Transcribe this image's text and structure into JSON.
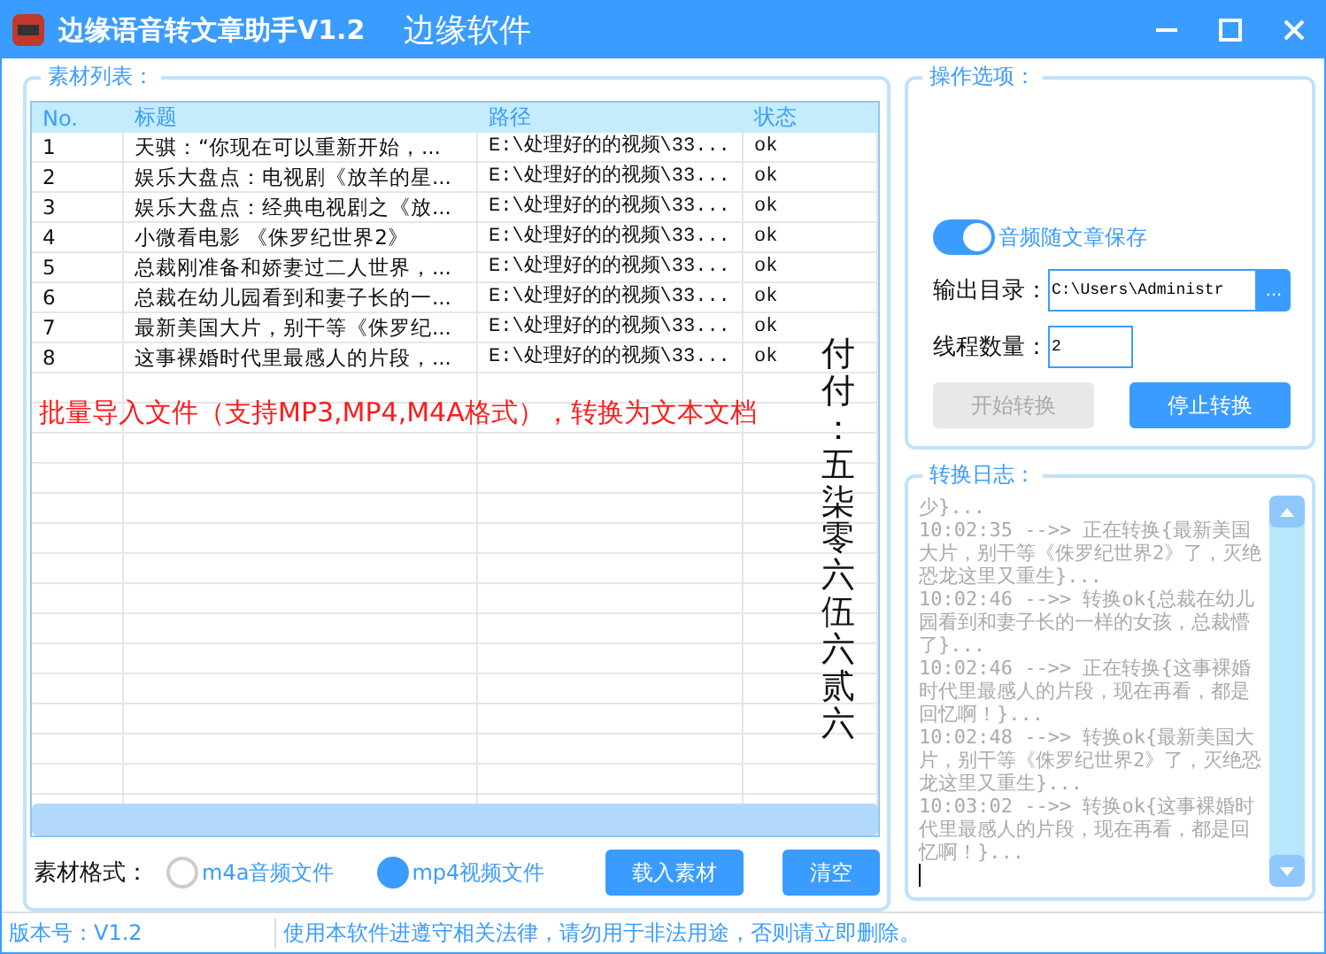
{
  "window": {
    "title": "边缘语音转文章助手V1.2",
    "subtitle": "边缘软件"
  },
  "materials": {
    "label": "素材列表：",
    "columns": [
      "No.",
      "标题",
      "路径",
      "状态"
    ],
    "rows": [
      {
        "no": "1",
        "title": "天骐：“你现在可以重新开始，...",
        "path": "E:\\处理好的的视频\\33...",
        "status": "ok"
      },
      {
        "no": "2",
        "title": "娱乐大盘点：电视剧《放羊的星...",
        "path": "E:\\处理好的的视频\\33...",
        "status": "ok"
      },
      {
        "no": "3",
        "title": "娱乐大盘点：经典电视剧之《放...",
        "path": "E:\\处理好的的视频\\33...",
        "status": "ok"
      },
      {
        "no": "4",
        "title": "小微看电影 《侏罗纪世界2》",
        "path": "E:\\处理好的的视频\\33...",
        "status": "ok"
      },
      {
        "no": "5",
        "title": "总裁刚准备和娇妻过二人世界，...",
        "path": "E:\\处理好的的视频\\33...",
        "status": "ok"
      },
      {
        "no": "6",
        "title": "总裁在幼儿园看到和妻子长的一...",
        "path": "E:\\处理好的的视频\\33...",
        "status": "ok"
      },
      {
        "no": "7",
        "title": "最新美国大片，别干等《侏罗纪...",
        "path": "E:\\处理好的的视频\\33...",
        "status": "ok"
      },
      {
        "no": "8",
        "title": "这事裸婚时代里最感人的片段，...",
        "path": "E:\\处理好的的视频\\33...",
        "status": "ok"
      }
    ],
    "notice": "批量导入文件（支持MP3,MP4,M4A格式），转换为文本文档",
    "overlay_text": "付付：五柒零六伍六贰六",
    "format_label": "素材格式：",
    "formats": [
      {
        "label": "m4a音频文件",
        "selected": false
      },
      {
        "label": "mp4视频文件",
        "selected": true
      }
    ],
    "buttons": [
      "载入素材",
      "清空"
    ]
  },
  "options": {
    "label": "操作选项：",
    "toggle": {
      "label": "音频随文章保存",
      "on": true
    },
    "output_dir": {
      "label": "输出目录：",
      "value": "C:\\Users\\Administr",
      "browse": "..."
    },
    "threads": {
      "label": "线程数量：",
      "value": "2"
    },
    "actions": [
      {
        "label": "开始转换",
        "disabled": true
      },
      {
        "label": "停止转换",
        "disabled": false
      }
    ]
  },
  "log": {
    "label": "转换日志：",
    "lines": [
      "少}...",
      "10:02:35 -->> 正在转换{最新美国大片，别干等《侏罗纪世界2》了，灭绝恐龙这里又重生}...",
      "10:02:46 -->> 转换ok{总裁在幼儿园看到和妻子长的一样的女孩，总裁懵了}...",
      "10:02:46 -->> 正在转换{这事裸婚时代里最感人的片段，现在再看，都是回忆啊！}...",
      "10:02:48 -->> 转换ok{最新美国大片，别干等《侏罗纪世界2》了，灭绝恐龙这里又重生}...",
      "10:03:02 -->> 转换ok{这事裸婚时代里最感人的片段，现在再看，都是回忆啊！}..."
    ]
  },
  "status_bar": {
    "version": "版本号：V1.2",
    "notice": "使用本软件进遵守相关法律，请勿用于非法用途，否则请立即删除。"
  }
}
